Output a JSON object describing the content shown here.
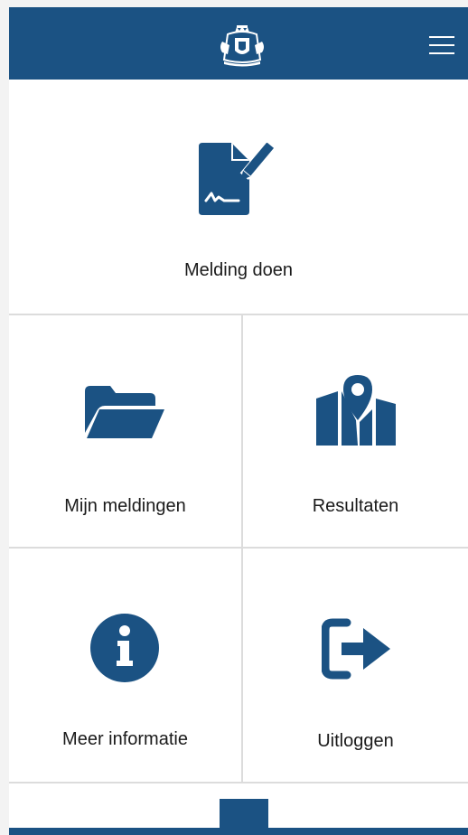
{
  "colors": {
    "brand": "#1b5283",
    "divider": "#dcdcdc",
    "text": "#1a1a1a",
    "background": "#ffffff"
  },
  "header": {
    "logo_icon": "coat-of-arms-icon",
    "menu_icon": "hamburger-menu-icon"
  },
  "tiles": {
    "melding_doen": {
      "label": "Melding doen",
      "icon": "document-sign-icon"
    },
    "mijn_meldingen": {
      "label": "Mijn meldingen",
      "icon": "folder-open-icon"
    },
    "resultaten": {
      "label": "Resultaten",
      "icon": "map-marker-icon"
    },
    "meer_informatie": {
      "label": "Meer informatie",
      "icon": "info-circle-icon"
    },
    "uitloggen": {
      "label": "Uitloggen",
      "icon": "sign-out-icon"
    }
  }
}
